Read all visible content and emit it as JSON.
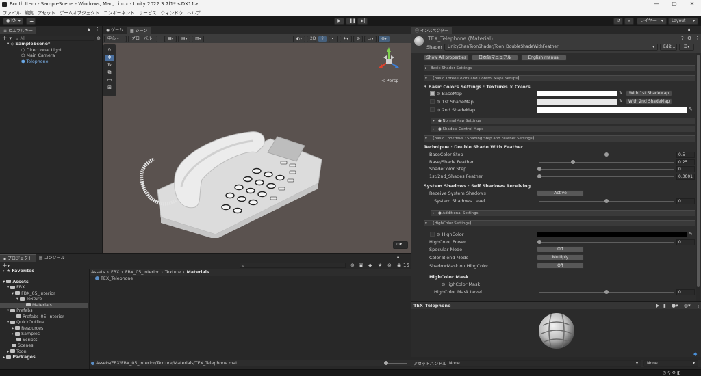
{
  "window": {
    "title": "Booth Item - SampleScene - Windows, Mac, Linux - Unity 2022.3.7f1* <DX11>"
  },
  "menu": [
    "ファイル",
    "編集",
    "アセット",
    "ゲームオブジェクト",
    "コンポーネント",
    "サービス",
    "ウィンドウ",
    "ヘルプ"
  ],
  "toolbar": {
    "account": "KN",
    "layers": "レイヤー",
    "layout": "Layout"
  },
  "hierarchy": {
    "tab": "ヒエラルキー",
    "search_placeholder": "All",
    "scene": "SampleScene*",
    "items": [
      "Directional Light",
      "Main Camera",
      "Telephone"
    ]
  },
  "scene_view": {
    "tabs": [
      "ゲーム",
      "シーン"
    ],
    "pivot": "中心",
    "global": "グローバル",
    "mode2d": "2D",
    "persp": "< Persp"
  },
  "project": {
    "tabs": [
      "プロジェクト",
      "コンソール"
    ],
    "favorites": "Favorites",
    "assets": "Assets",
    "tree": [
      "FBX",
      "FBX_05_Interior",
      "Texture",
      "Materials",
      "Prefabs",
      "Prefabs_05_Interior",
      "QuickOutline",
      "Resources",
      "Samples",
      "Scripts",
      "Scenes",
      "Toon"
    ],
    "packages": "Packages",
    "breadcrumb": [
      "Assets",
      "FBX",
      "FBX_05_Interior",
      "Texture",
      "Materials"
    ],
    "file": "TEX_Telephone",
    "count": "15",
    "path": "Assets/FBX/FBX_05_Interior/Texture/Materials/TEX_Telephone.mat"
  },
  "inspector": {
    "tab": "インスペクター",
    "material_name": "TEX_Telephone (Material)",
    "shader_label": "Shader",
    "shader_value": "UnityChanToonShader/Toon_DoubleShadeWithFeather",
    "edit": "Edit...",
    "buttons": [
      "Show All properties",
      "日本語マニュアル",
      "English manual"
    ],
    "sections": {
      "basic_shader": "Basic Shader Settings",
      "three_colors": "【Basic Three Colors and Control Maps Setups】",
      "normal": "● NormalMap Settings",
      "shadow_ctrl": "● Shadow Control Maps",
      "lookdevs": "【Basic Lookdevs : Shading Step and Feather Settings】",
      "additional": "● Additional Settings",
      "highcolor": "【HighColor Settings】"
    },
    "three_colors_title": "3 Basic Colors Settings : Textures × Colors",
    "basemap": "BaseMap",
    "shademap1": "1st ShadeMap",
    "shademap2": "2nd ShadeMap",
    "with1st": "With 1st ShadeMap",
    "with2nd": "With 2nd ShadeMap",
    "technique_title": "Technipue : Double Shade With Feather",
    "sliders": [
      {
        "label": "BaseColor Step",
        "value": "0.5",
        "fraction": 0.5
      },
      {
        "label": "Base/Shade Feather",
        "value": "0.25",
        "fraction": 0.25
      },
      {
        "label": "ShadeColor Step",
        "value": "0",
        "fraction": 0
      },
      {
        "label": "1st/2nd_Shades Feather",
        "value": "0.0001",
        "fraction": 0
      }
    ],
    "system_shadows_title": "System Shadows : Self Shadows Receiving",
    "receive_label": "Receive System Shadows",
    "receive_value": "Active",
    "sys_level_label": "System Shadows Level",
    "sys_level_value": "0",
    "highcolor_label": "HighColor",
    "highcolor_power_label": "HighColor Power",
    "highcolor_power_value": "0",
    "specular_label": "Specular Mode",
    "specular_value": "Off",
    "blend_label": "Color Blend Mode",
    "blend_value": "Multiply",
    "shadowmask_label": "ShadowMask on HihgColor",
    "shadowmask_value": "Off",
    "hc_mask_title": "HighColor Mask",
    "hc_mask_label": "HighColor Mask",
    "hc_mask_level_label": "HighColor Mask Level",
    "hc_mask_level_value": "0",
    "preview_title": "TEX_Telephone",
    "asset_bundle_label": "アセットバンドル",
    "bundle_value1": "None",
    "bundle_value2": "None"
  },
  "colors": {
    "accent": "#3a79bb",
    "selection": "#2c5d87"
  }
}
